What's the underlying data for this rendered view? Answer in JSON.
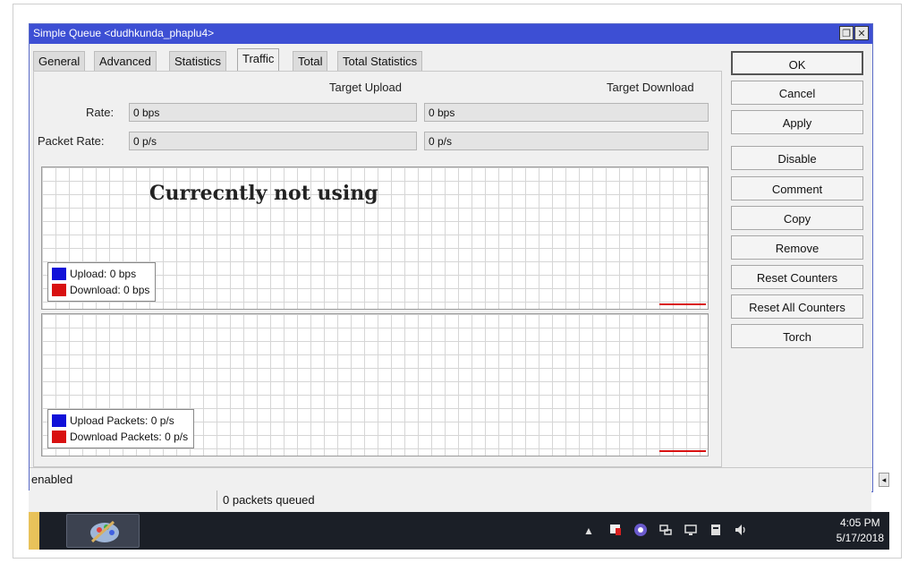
{
  "window": {
    "title": "Simple Queue <dudhkunda_phaplu4>",
    "restore_glyph": "❐",
    "close_glyph": "✕"
  },
  "tabs": [
    {
      "label": "General",
      "active": false
    },
    {
      "label": "Advanced",
      "active": false
    },
    {
      "label": "Statistics",
      "active": false
    },
    {
      "label": "Traffic",
      "active": true
    },
    {
      "label": "Total",
      "active": false
    },
    {
      "label": "Total Statistics",
      "active": false
    }
  ],
  "traffic": {
    "col_upload": "Target Upload",
    "col_download": "Target Download",
    "rate_label": "Rate:",
    "rate_upload": "0 bps",
    "rate_download": "0 bps",
    "packet_rate_label": "Packet Rate:",
    "packet_rate_upload": "0 p/s",
    "packet_rate_download": "0 p/s"
  },
  "graph_bytes": {
    "overlay_text": "Currecntly not using",
    "legend": [
      {
        "label": "Upload:",
        "value": "0 bps",
        "color": "#1010d8"
      },
      {
        "label": "Download:",
        "value": "0 bps",
        "color": "#d81010"
      }
    ]
  },
  "graph_packets": {
    "legend": [
      {
        "label": "Upload Packets:",
        "value": "0 p/s",
        "color": "#1010d8"
      },
      {
        "label": "Download Packets:",
        "value": "0 p/s",
        "color": "#d81010"
      }
    ]
  },
  "buttons": [
    "OK",
    "Cancel",
    "Apply",
    "Disable",
    "Comment",
    "Copy",
    "Remove",
    "Reset Counters",
    "Reset All Counters",
    "Torch"
  ],
  "status": {
    "state": "enabled",
    "queued": "0 packets queued"
  },
  "taskbar": {
    "time": "4:05 PM",
    "date": "5/17/2018",
    "tray_icons": [
      "show-hidden-icon",
      "flag-icon",
      "app-tray-icon",
      "network-icon",
      "monitor-icon",
      "speaker-icon"
    ],
    "chevron": "▲"
  },
  "colors": {
    "titlebar": "#3d4fd4",
    "upload": "#1010d8",
    "download": "#d81010"
  }
}
